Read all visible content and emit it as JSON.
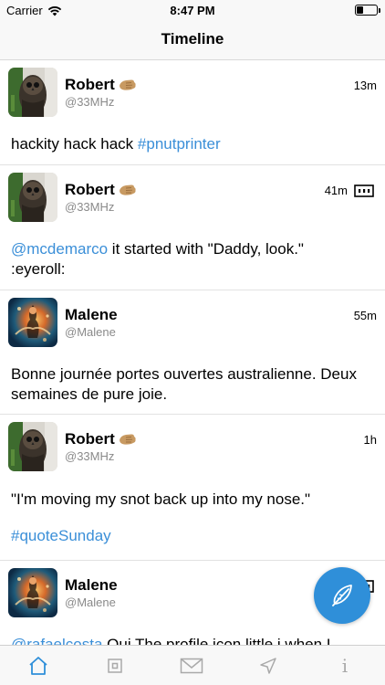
{
  "status_bar": {
    "carrier": "Carrier",
    "time": "8:47 PM",
    "battery_level": 0.35
  },
  "nav": {
    "title": "Timeline"
  },
  "posts": [
    {
      "name": "Robert",
      "handle": "@33MHz",
      "time": "13m",
      "text": "hackity hack hack ",
      "link": "#pnutprinter",
      "avatar": "owl-avatar",
      "has_thread_icon": false
    },
    {
      "name": "Robert",
      "handle": "@33MHz",
      "time": "41m",
      "mention": "@mcdemarco",
      "text_line1": " it started with \"Daddy, look.\"",
      "text_line2": ":eyeroll:",
      "avatar": "owl-avatar",
      "has_thread_icon": true
    },
    {
      "name": "Malene",
      "handle": "@Malene",
      "time": "55m",
      "text_line1": "Bonne journée portes ouvertes australienne. Deux",
      "text_line2": "semaines de pure joie.",
      "avatar": "fire-figure-avatar",
      "has_thread_icon": false
    },
    {
      "name": "Robert",
      "handle": "@33MHz",
      "time": "1h",
      "text": "\"I'm moving my snot back up into my nose.\"",
      "link": "#quoteSunday",
      "avatar": "owl-avatar",
      "has_thread_icon": false
    },
    {
      "name": "Malene",
      "handle": "@Malene",
      "mention": "@rafaelcosta",
      "text": " Oui The profile icon little i when I",
      "avatar": "fire-figure-avatar",
      "has_thread_icon": true
    }
  ],
  "tabs": [
    {
      "name": "home-icon",
      "active": true
    },
    {
      "name": "square-icon",
      "active": false
    },
    {
      "name": "mail-icon",
      "active": false
    },
    {
      "name": "navigation-arrow-icon",
      "active": false
    },
    {
      "name": "info-icon",
      "label": "i",
      "active": false
    }
  ],
  "colors": {
    "accent": "#2f8fd9",
    "link": "#3b8fd8",
    "handle": "#8a8a8a",
    "bar_background": "#f8f8f8"
  },
  "icons": {
    "badge": "hand-emoji-icon",
    "compose": "feather-icon",
    "thread": "thread-icon"
  }
}
